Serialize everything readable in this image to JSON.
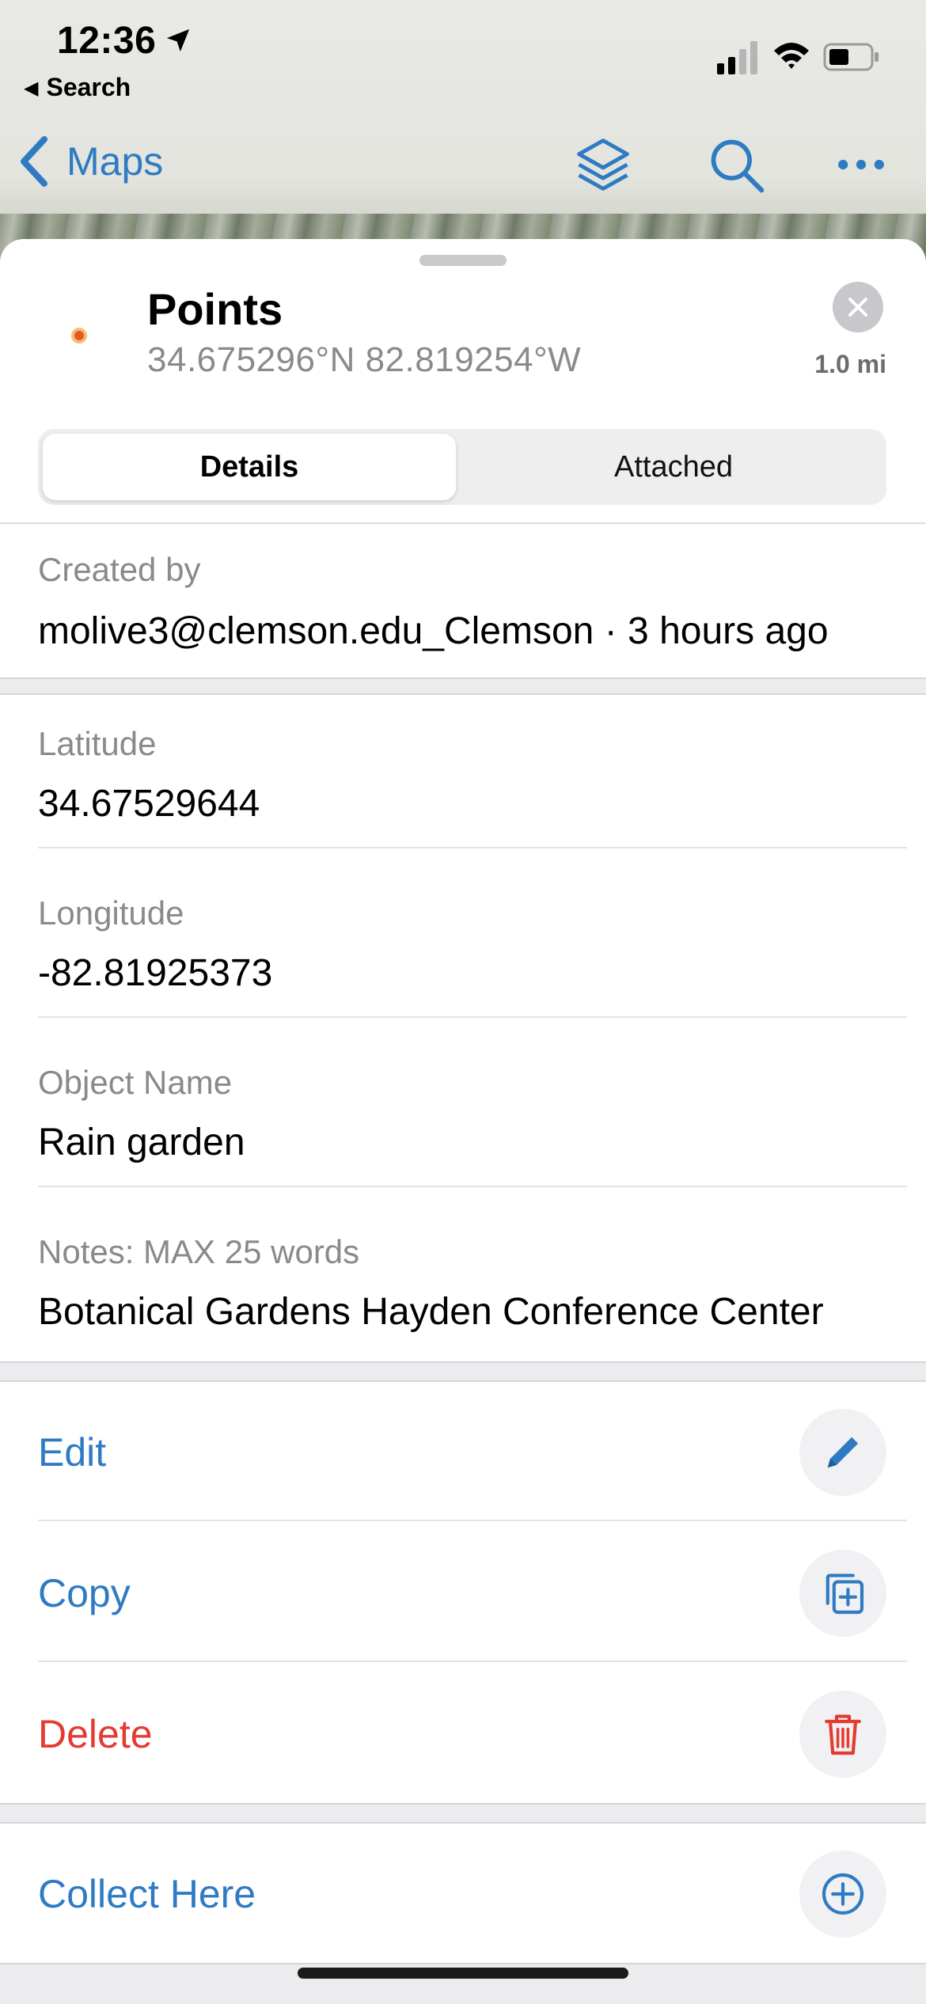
{
  "status_bar": {
    "time": "12:36",
    "back_label": "Search"
  },
  "nav": {
    "back_label": "Maps",
    "icons": [
      "layers-icon",
      "search-icon",
      "more-icon"
    ]
  },
  "header": {
    "title": "Points",
    "coordinates": "34.675296°N  82.819254°W",
    "distance": "1.0 mi"
  },
  "tabs": {
    "details": "Details",
    "attached": "Attached",
    "selected": "Details"
  },
  "meta": {
    "created_label": "Created by",
    "created_value": "molive3@clemson.edu_Clemson · 3 hours ago"
  },
  "fields": [
    {
      "label": "Latitude",
      "value": "34.67529644"
    },
    {
      "label": "Longitude",
      "value": "-82.81925373"
    },
    {
      "label": "Object Name",
      "value": "Rain garden"
    },
    {
      "label": "Notes: MAX 25 words",
      "value": "Botanical Gardens Hayden Conference Center"
    }
  ],
  "actions": {
    "edit": "Edit",
    "copy": "Copy",
    "delete": "Delete",
    "collect": "Collect Here"
  },
  "colors": {
    "accent": "#2f7bc3",
    "danger": "#e53a30",
    "point_marker": "#e7562a"
  }
}
